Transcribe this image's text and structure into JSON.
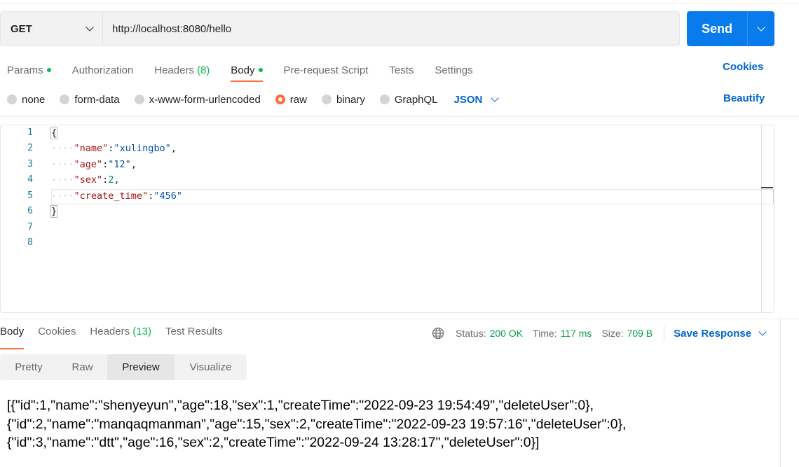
{
  "request": {
    "method": "GET",
    "url": "http://localhost:8080/hello",
    "send_label": "Send"
  },
  "request_tabs": [
    {
      "label": "Params",
      "dot": true,
      "active": false
    },
    {
      "label": "Authorization",
      "active": false
    },
    {
      "label": "Headers",
      "count": "(8)",
      "active": false
    },
    {
      "label": "Body",
      "dot": true,
      "active": true
    },
    {
      "label": "Pre-request Script",
      "active": false
    },
    {
      "label": "Tests",
      "active": false
    },
    {
      "label": "Settings",
      "active": false
    }
  ],
  "cookies_label": "Cookies",
  "body_types": [
    {
      "label": "none",
      "selected": false
    },
    {
      "label": "form-data",
      "selected": false
    },
    {
      "label": "x-www-form-urlencoded",
      "selected": false
    },
    {
      "label": "raw",
      "selected": true
    },
    {
      "label": "binary",
      "selected": false
    },
    {
      "label": "GraphQL",
      "selected": false
    }
  ],
  "body_format": "JSON",
  "beautify_label": "Beautify",
  "editor": {
    "line_numbers": [
      "1",
      "2",
      "3",
      "4",
      "5",
      "6",
      "7",
      "8"
    ],
    "lines": {
      "l1": "{",
      "l2_key": "\"name\"",
      "l2_val": "\"xulingbo\"",
      "l3_key": "\"age\"",
      "l3_val": "\"12\"",
      "l4_key": "\"sex\"",
      "l4_val": "2",
      "l5_key": "\"create_time\"",
      "l5_val": "\"456\"",
      "l6": "}"
    }
  },
  "response_tabs": [
    {
      "label": "Body",
      "active": true
    },
    {
      "label": "Cookies",
      "active": false
    },
    {
      "label": "Headers",
      "count": "(13)",
      "active": false
    },
    {
      "label": "Test Results",
      "active": false
    }
  ],
  "response_meta": {
    "status_label": "Status:",
    "status_value": "200 OK",
    "time_label": "Time:",
    "time_value": "117 ms",
    "size_label": "Size:",
    "size_value": "709 B",
    "save_label": "Save Response"
  },
  "view_modes": [
    {
      "label": "Pretty",
      "active": false
    },
    {
      "label": "Raw",
      "active": false
    },
    {
      "label": "Preview",
      "active": true
    },
    {
      "label": "Visualize",
      "active": false
    }
  ],
  "preview_lines": [
    "[{\"id\":1,\"name\":\"shenyeyun\",\"age\":18,\"sex\":1,\"createTime\":\"2022-09-23 19:54:49\",\"deleteUser\":0},",
    "{\"id\":2,\"name\":\"manqaqmanman\",\"age\":15,\"sex\":2,\"createTime\":\"2022-09-23 19:57:16\",\"deleteUser\":0},",
    "{\"id\":3,\"name\":\"dtt\",\"age\":16,\"sex\":2,\"createTime\":\"2022-09-24 13:28:17\",\"deleteUser\":0}]"
  ],
  "colors": {
    "accent": "#ff6c37",
    "send": "#097bed",
    "link": "#0265d2",
    "success": "#0cbb52"
  }
}
